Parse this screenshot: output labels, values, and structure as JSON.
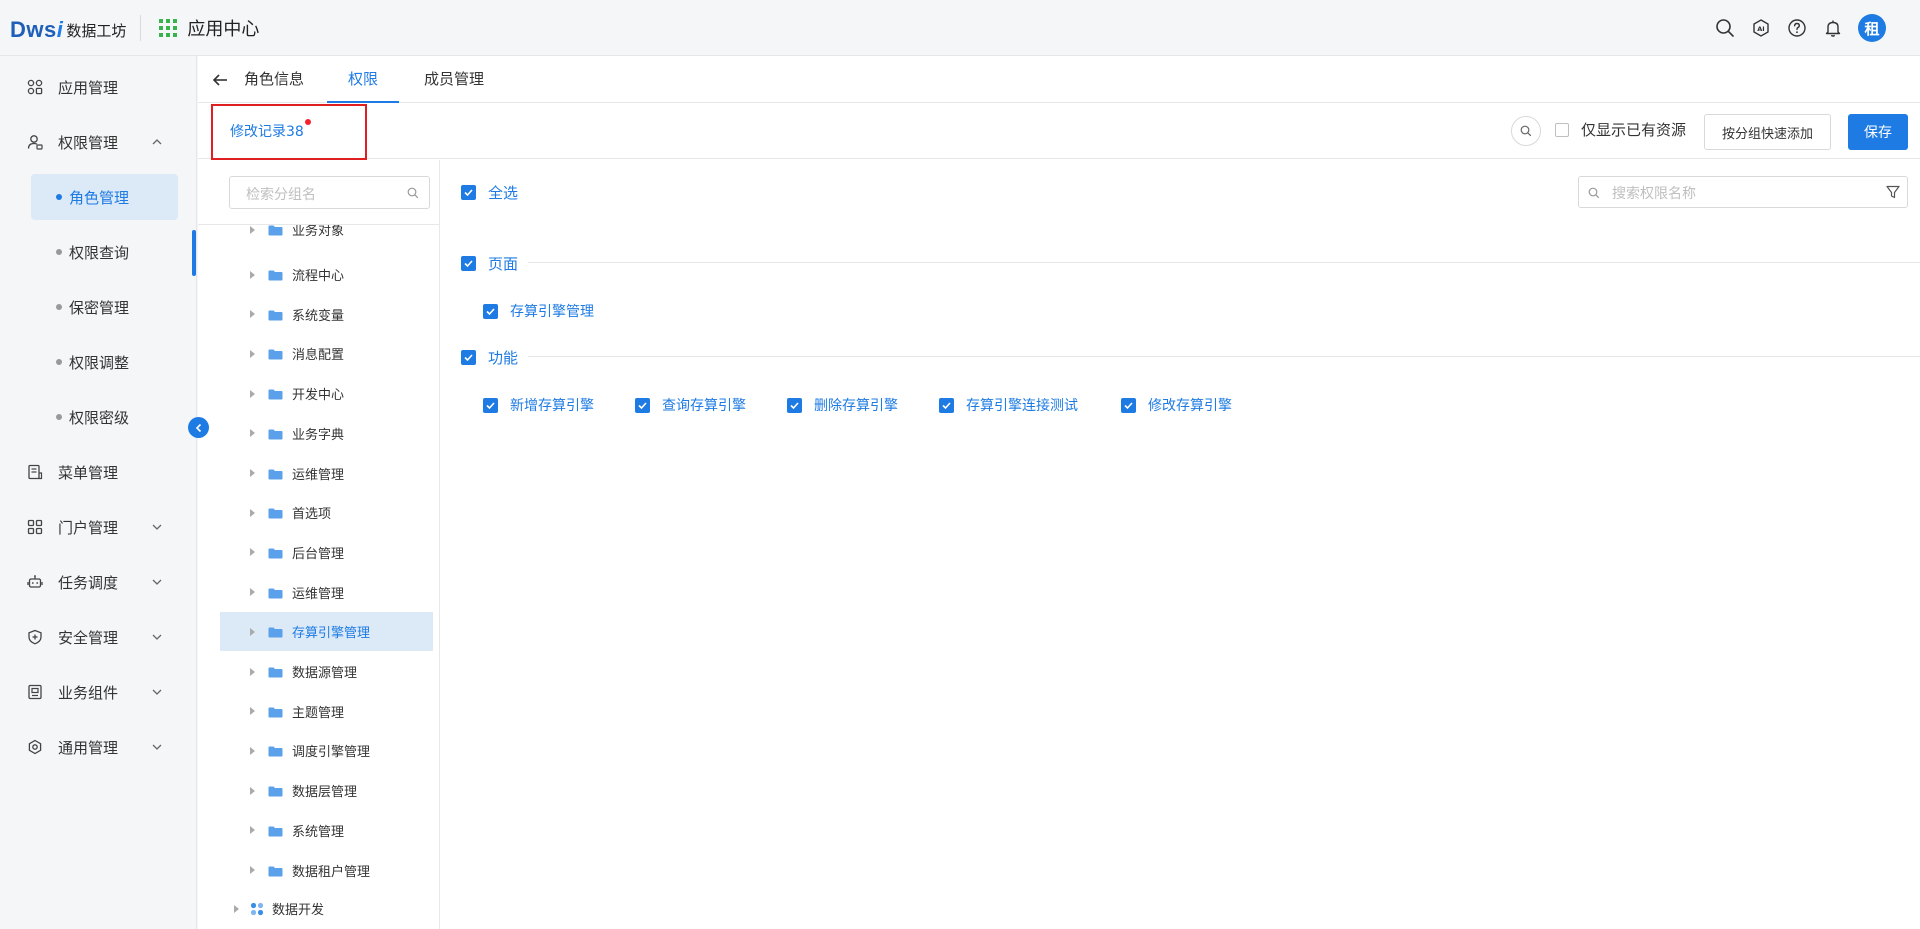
{
  "header": {
    "logo_mark": "Dws",
    "logo_mark_i": "i",
    "logo_text": "数据工坊",
    "app_title": "应用中心",
    "avatar_text": "租"
  },
  "sidebar": {
    "items": [
      {
        "label": "应用管理",
        "icon": "apps-icon"
      },
      {
        "label": "权限管理",
        "icon": "user-lock-icon",
        "expanded": true
      },
      {
        "label": "菜单管理",
        "icon": "menu-doc-icon"
      },
      {
        "label": "门户管理",
        "icon": "portal-icon"
      },
      {
        "label": "任务调度",
        "icon": "robot-icon"
      },
      {
        "label": "安全管理",
        "icon": "shield-icon"
      },
      {
        "label": "业务组件",
        "icon": "component-icon"
      },
      {
        "label": "通用管理",
        "icon": "settings-icon"
      }
    ],
    "sub_items": [
      {
        "label": "角色管理",
        "active": true
      },
      {
        "label": "权限查询"
      },
      {
        "label": "保密管理"
      },
      {
        "label": "权限调整"
      },
      {
        "label": "权限密级"
      }
    ]
  },
  "tabs": [
    {
      "label": "角色信息"
    },
    {
      "label": "权限",
      "active": true
    },
    {
      "label": "成员管理"
    }
  ],
  "toolbar": {
    "record_link": "修改记录38",
    "only_own_label": "仅显示已有资源",
    "quick_add_label": "按分组快速添加",
    "save_label": "保存"
  },
  "tree": {
    "search_placeholder": "检索分组名",
    "partial_top": "业务对象",
    "items": [
      {
        "label": "流程中心"
      },
      {
        "label": "系统变量"
      },
      {
        "label": "消息配置"
      },
      {
        "label": "开发中心"
      },
      {
        "label": "业务字典"
      },
      {
        "label": "运维管理"
      },
      {
        "label": "首选项"
      },
      {
        "label": "后台管理"
      },
      {
        "label": "运维管理"
      },
      {
        "label": "存算引擎管理",
        "active": true
      },
      {
        "label": "数据源管理"
      },
      {
        "label": "主题管理"
      },
      {
        "label": "调度引擎管理"
      },
      {
        "label": "数据层管理"
      },
      {
        "label": "系统管理"
      },
      {
        "label": "数据租户管理"
      }
    ],
    "root_next": "数据开发"
  },
  "permissions": {
    "select_all_label": "全选",
    "search_placeholder": "搜索权限名称",
    "sections": [
      {
        "title": "页面",
        "items": [
          {
            "label": "存算引擎管理"
          }
        ]
      },
      {
        "title": "功能",
        "items": [
          {
            "label": "新增存算引擎"
          },
          {
            "label": "查询存算引擎"
          },
          {
            "label": "删除存算引擎"
          },
          {
            "label": "存算引擎连接测试"
          },
          {
            "label": "修改存算引擎"
          }
        ]
      }
    ]
  },
  "colors": {
    "accent": "#1e7be3",
    "active_bg": "#dce9f7",
    "highlight_border": "#e02020",
    "grid_icon": "#37b24d"
  }
}
